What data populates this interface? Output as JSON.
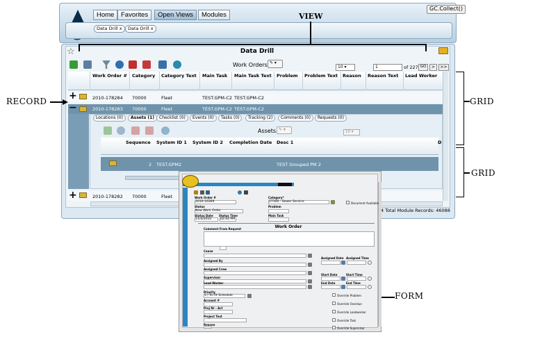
{
  "annotations": {
    "view": "VIEW",
    "record": "RECORD",
    "grid_top": "GRID",
    "grid_bottom": "GRID",
    "form": "FORM"
  },
  "nav": {
    "tabs": [
      "Home",
      "Favorites",
      "Open Views",
      "Modules"
    ],
    "active": "Open Views",
    "gc_button": "GC.Collect()"
  },
  "view_tabs": [
    {
      "label": "Data Drill",
      "close": "x"
    },
    {
      "label": "Data Drill",
      "close": "x"
    }
  ],
  "panel": {
    "title": "Data Drill",
    "view_selector": "Work Orders",
    "page_size": "10",
    "page_input": "1",
    "page_of": "of 227",
    "go": "GO",
    "next": ">",
    "last": ">>",
    "footer": "4  Total Module Records: 46088"
  },
  "grid": {
    "columns": [
      "Work Order #",
      "Category",
      "Category Text",
      "Main Task",
      "Main Task Text",
      "Problem",
      "Problem Text",
      "Reason",
      "Reason Text",
      "Lead Worker"
    ],
    "rows": [
      {
        "expander": "+",
        "work_order": "2010-178284",
        "category": "70000",
        "category_text": "Fleet",
        "main_task": "TEST.GPM-C2",
        "main_task_text": "TEST.GPM-C2"
      },
      {
        "expander": "−",
        "work_order": "2010-178283",
        "category": "70000",
        "category_text": "Fleet",
        "main_task": "TEST.GPM-C2",
        "main_task_text": "TEST.GPM-C2"
      },
      {
        "expander": "+",
        "work_order": "2010-178282",
        "category": "70000",
        "category_text": "Fleet"
      }
    ]
  },
  "detail": {
    "tabs": [
      "Locations (0)",
      "Assets (1)",
      "Checklist (0)",
      "Events (0)",
      "Tasks (0)",
      "Tracking (2)",
      "Comments (0)",
      "Requests (0)"
    ],
    "active": "Assets (1)",
    "view_selector": "Assets",
    "page_size": "10",
    "columns": [
      "Sequence",
      "System ID 1",
      "System ID 2",
      "Completion Date",
      "Desc 1",
      "D"
    ],
    "rows": [
      {
        "sequence": "2",
        "system_id_1": "TEST.GPM2",
        "desc_1": "TEST Grouped PM 2"
      }
    ]
  },
  "form": {
    "work_order_label": "Work Order #",
    "work_order": "2010-16369",
    "category_label": "Category*",
    "category": "27300 : Sewer Service",
    "status_label": "Status",
    "status": "New Work Order",
    "problem_label": "Problem",
    "status_date_label": "Status Date",
    "status_time_label": "Status Time",
    "status_date": "11/4/2010",
    "status_time": "02:04 PM",
    "main_task_label": "Main Task",
    "document_available": "Document Available",
    "section_title": "Work Order",
    "comment_label": "Comment From Request",
    "cause_label": "Cause",
    "assigned_by_label": "Assigned By",
    "assigned_date_label": "Assigned Date",
    "assigned_time_label": "Assigned Time",
    "assigned_crew_label": "Assigned Crew",
    "supervisor_label": "Supervisor",
    "start_date_label": "Start Date",
    "start_time_label": "Start Time",
    "lead_worker_label": "Lead Worker",
    "end_date_label": "End Date",
    "end_time_label": "End Time",
    "priority_label": "Priority",
    "priority": "5 | To Fit Schedule",
    "account_label": "Account #",
    "proj_label": "Proj Nr - Act",
    "project_text_label": "Project Text",
    "reason_label": "Reason",
    "checks": [
      "Override Problem",
      "Override Overdue",
      "Override Leadworker",
      "Override Task",
      "Override Supervisor"
    ]
  }
}
